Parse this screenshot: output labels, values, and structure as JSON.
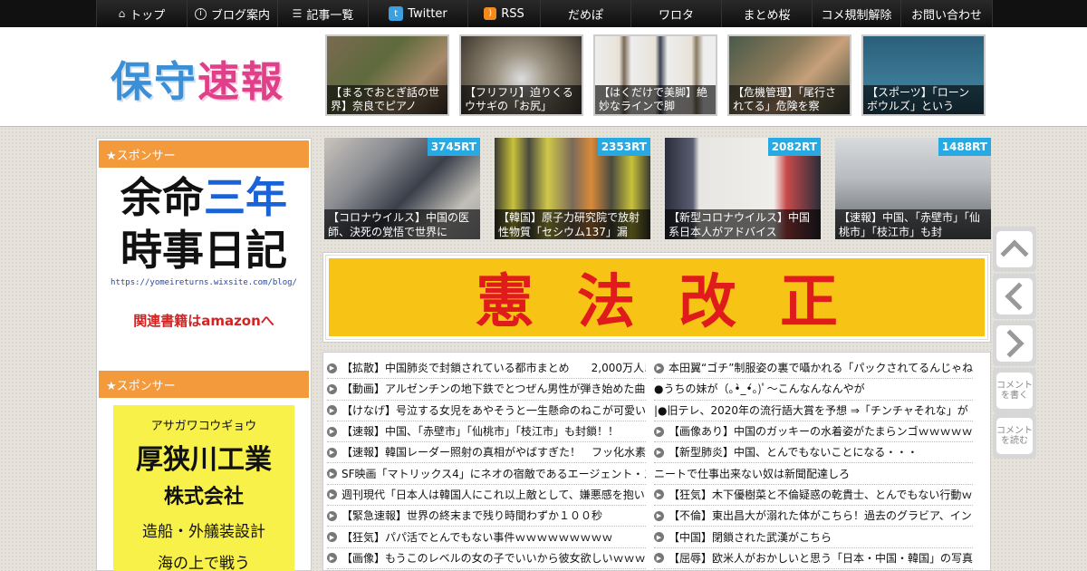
{
  "nav": {
    "items": [
      {
        "label": "トップ",
        "icon": "home-icon"
      },
      {
        "label": "ブログ案内",
        "icon": "info-icon"
      },
      {
        "label": "記事一覧",
        "icon": "list-icon"
      },
      {
        "label": "Twitter",
        "icon": "twitter-icon"
      },
      {
        "label": "RSS",
        "icon": "rss-icon"
      },
      {
        "label": "だめぽ"
      },
      {
        "label": "ワロタ"
      },
      {
        "label": "まとめ桜"
      },
      {
        "label": "コメ規制解除"
      },
      {
        "label": "お問い合わせ"
      }
    ]
  },
  "header": {
    "logo_part1": "保守",
    "logo_part2": "速報",
    "thumbs": [
      {
        "caption": "【まるでおとぎ話の世界】奈良でピアノ"
      },
      {
        "caption": "【フリフリ】迫りくるウサギの「お尻」"
      },
      {
        "caption": "【はくだけで美脚】絶妙なラインで脚"
      },
      {
        "caption": "【危機管理】「尾行されてる」危険を察"
      },
      {
        "caption": "【スポーツ】「ローンボウルズ」という"
      }
    ]
  },
  "sidebar": {
    "sponsor1": "★スポンサー",
    "ad1": {
      "line1a": "余命",
      "line1b": "三年",
      "line2": "時事日記",
      "url": "https://yomeireturns.wixsite.com/blog/",
      "amazon": "関連書籍はamazonへ"
    },
    "sponsor2": "★スポンサー",
    "ad2": {
      "kana": "アサガワコウギョウ",
      "name": "厚狭川工業",
      "corp": "株式会社",
      "business": "造船・外艤装設計",
      "more": "海の上で戦う"
    }
  },
  "rt_thumbs": [
    {
      "badge": "3745RT",
      "caption": "【コロナウイルス】中国の医師、決死の覚悟で世界に"
    },
    {
      "badge": "2353RT",
      "caption": "【韓国】原子力研究院で放射性物質「セシウム137」漏"
    },
    {
      "badge": "2082RT",
      "caption": "【新型コロナウイルス】中国系日本人がアドバイス"
    },
    {
      "badge": "1488RT",
      "caption": "【速報】中国、「赤壁市」「仙桃市」「枝江市」も封"
    }
  ],
  "banner": {
    "text": "憲法改正"
  },
  "links": {
    "left": [
      "【拡散】中国肺炎で封鎖されている都市まとめ　　2,000万人以",
      "【動画】アルゼンチンの地下鉄でとつぜん男性が弾き始めた曲",
      "【けなげ】号泣する女児をあやそうと一生懸命のねこが可愛い",
      "【速報】中国、「赤壁市」「仙桃市」「枝江市」も封鎖！！",
      "【速報】韓国レーダー照射の真相がやばすぎた！　フッ化水素",
      "SF映画「マトリックス4」にネオの宿敵であるエージェント・ス",
      "週刊現代「日本人は韓国人にこれ以上敵として、嫌悪感を抱い",
      "【緊急速報】世界の終末まで残り時間わずか１００秒",
      "【狂気】パパ活でとんでもない事件ｗｗｗｗｗｗｗｗｗ",
      "【画像】もうこのレベルの女の子でいいから彼女欲しいｗｗｗ"
    ],
    "right": [
      "本田翼“ゴチ”制服姿の裏で囁かれる「パックされてるんじゃね",
      "●うちの妹が（｡•̀_•́｡)ﾟ～こんなんなんやが",
      "|●旧テレ、2020年の流行語大賞を予想 ⇒「チンチャそれな」が",
      "【画像あり】中国のガッキーの水着姿がたまらンゴｗｗｗｗｗ",
      "【新型肺炎】中国、とんでもないことになる・・・",
      "ニートで仕事出来ない奴は新聞配達しろ",
      "【狂気】木下優樹菜と不倫疑惑の乾貴士、とんでもない行動ｗ",
      "【不倫】東出昌大が溺れた体がこちら！過去のグラビア、イン",
      "【中国】閉鎖された武漢がこちら",
      "【屈辱】欧米人がおかしいと思う「日本・中国・韓国」の写真"
    ]
  },
  "float": {
    "write_comment": "コメントを書く",
    "read_comment": "コメントを読む"
  }
}
